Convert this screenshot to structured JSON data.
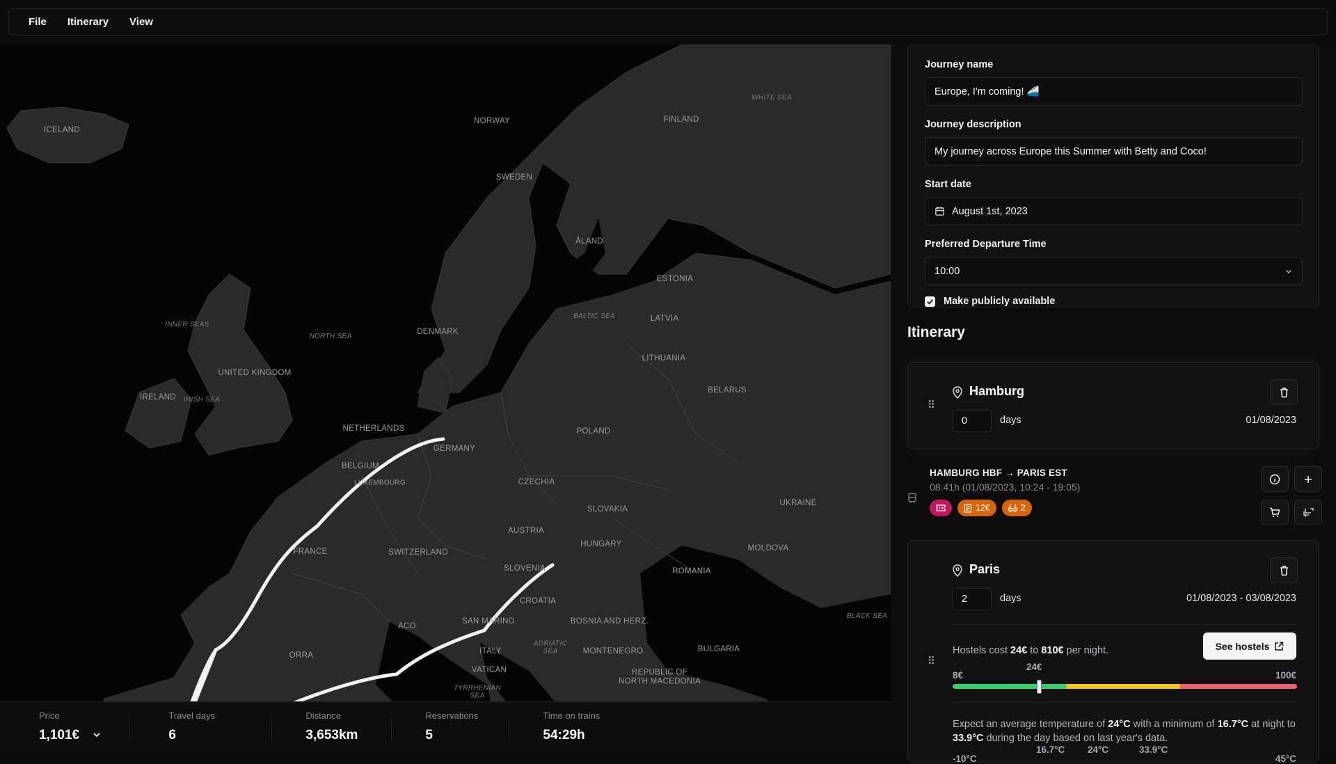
{
  "menu": {
    "file": "File",
    "itinerary": "Itinerary",
    "view": "View"
  },
  "map": {
    "labels": {
      "iceland": "ICELAND",
      "norway": "NORWAY",
      "finland": "FINLAND",
      "sweden": "SWEDEN",
      "aland": "ÅLAND",
      "estonia": "ESTONIA",
      "latvia": "LATVIA",
      "lithuania": "LITHUANIA",
      "denmark": "DENMARK",
      "belarus": "BELARUS",
      "uk": "UNITED KINGDOM",
      "ireland": "IRELAND",
      "netherlands": "NETHERLANDS",
      "germany": "GERMANY",
      "poland": "POLAND",
      "belgium": "BELGIUM",
      "luxembourg": "LUXEMBOURG",
      "czechia": "CZECHIA",
      "slovakia": "SLOVAKIA",
      "ukraine": "UKRAINE",
      "austria": "AUSTRIA",
      "hungary": "HUNGARY",
      "moldova": "MOLDOVA",
      "france": "FRANCE",
      "switzerland": "SWITZERLAND",
      "slovenia": "SLOVENIA",
      "romania": "ROMANIA",
      "croatia": "CROATIA",
      "san_marino": "SAN MARINO",
      "bosnia": "BOSNIA AND HERZ.",
      "monaco": "ACO",
      "andorra": "ORRA",
      "italy": "ITALY",
      "montenegro": "MONTENEGRO",
      "bulgaria": "BULGARIA",
      "vatican": "VATICAN",
      "north_macedonia": "REPUBLIC OF NORTH MACEDONIA"
    },
    "seas": {
      "white_sea": "WHITE SEA",
      "baltic_sea": "BALTIC SEA",
      "north_sea": "NORTH SEA",
      "inner_seas": "INNER SEAS",
      "irish_sea": "IRISH SEA",
      "adriatic_sea": "ADRIATIC SEA",
      "black_sea": "BLACK SEA",
      "tyrrhenian_sea": "TYRRHENIAN SEA"
    }
  },
  "stats": {
    "price": {
      "label": "Price",
      "value": "1,101€"
    },
    "travel_days": {
      "label": "Travel days",
      "value": "6"
    },
    "distance": {
      "label": "Distance",
      "value": "3,653km"
    },
    "reservations": {
      "label": "Reservations",
      "value": "5"
    },
    "time_on_trains": {
      "label": "Time on trains",
      "value": "54:29h"
    }
  },
  "form": {
    "name_label": "Journey name",
    "name_value": "Europe, I'm coming! 🚄",
    "description_label": "Journey description",
    "description_value": "My journey across Europe this Summer with Betty and Coco!",
    "start_label": "Start date",
    "start_value": "August 1st, 2023",
    "departure_label": "Preferred Departure Time",
    "departure_value": "10:00",
    "public_label": "Make publicly available",
    "public_checked": true
  },
  "itinerary": {
    "title": "Itinerary",
    "stops": [
      {
        "city": "Hamburg",
        "days": "0",
        "days_label": "days",
        "date": "01/08/2023"
      },
      {
        "city": "Paris",
        "days": "2",
        "days_label": "days",
        "date": "01/08/2023 - 03/08/2023",
        "hostels": {
          "prefix": "Hostels cost ",
          "min": "24€",
          "mid": " to ",
          "max": "810€",
          "suffix": " per night.",
          "button": "See hostels"
        },
        "slider": {
          "low": "8€",
          "current": "24€",
          "high": "100€",
          "position": 0.25
        },
        "temperature": {
          "p1": "Expect an average temperature of ",
          "avg": "24°C",
          "p2": " with a minimum of ",
          "min": "16.7°C",
          "p3": " at night to ",
          "max": "33.9°C",
          "p4": " during the day based on last year's data.",
          "scale": [
            "-10°C",
            "16.7°C",
            "24°C",
            "33.9°C",
            "45°C"
          ]
        }
      }
    ],
    "train": {
      "route": "HAMBURG HBF → PARIS EST",
      "details": "08:41h (01/08/2023, 10:24 - 19:05)",
      "price_badge": "12€",
      "seats_badge": "2"
    }
  },
  "colors": {
    "accent_pink": "#c2185b",
    "accent_orange": "#d9650b",
    "route": "#f2f2f2"
  }
}
